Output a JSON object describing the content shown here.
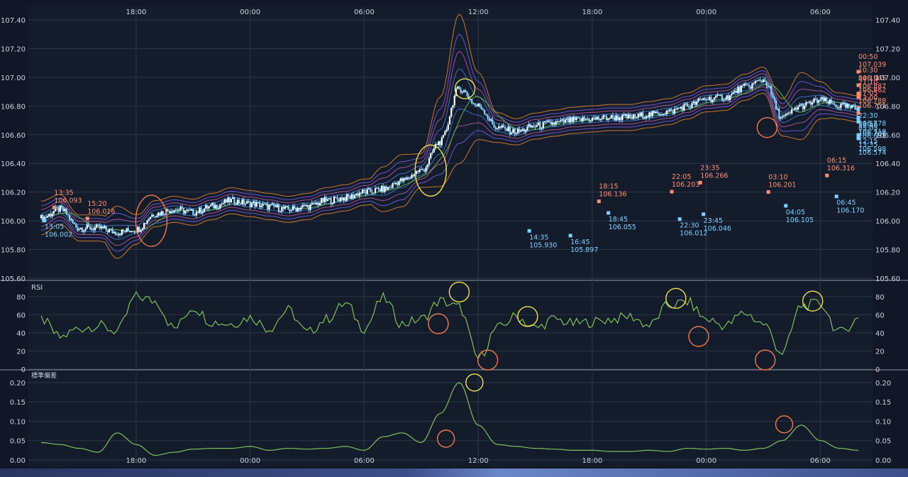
{
  "colors": {
    "background": "#111726",
    "panel": "#131b2b",
    "grid": "#2b3548",
    "axis_text": "#c9d1dd",
    "candle": "#8fd3ff",
    "high_label": "#ff8f70",
    "low_label": "#7fd0ff",
    "rsi_line": "#7fbf5a",
    "std_line": "#7fbf5a",
    "circle_orange": "#f07a4a",
    "circle_yellow": "#f0e050",
    "band_outer": "#e8872a",
    "band_mid": "#7d5ce6",
    "band_inner": "#c05aa8",
    "band_core": "#4a7ad0",
    "ma_line": "#5fb04a"
  },
  "time_axis": {
    "top_ticks": [
      "18:00",
      "00:00",
      "06:00",
      "12:00",
      "18:00",
      "00:00",
      "06:00"
    ],
    "bottom_ticks": [
      "18:00",
      "00:00",
      "06:00",
      "12:00",
      "18:00",
      "00:00",
      "06:00"
    ]
  },
  "price_panel": {
    "yticks": [
      "107.40",
      "107.20",
      "107.00",
      "106.80",
      "106.60",
      "106.40",
      "106.20",
      "106.00",
      "105.80",
      "105.60"
    ],
    "annotations": [
      {
        "time": "13:35",
        "price": "106.093",
        "kind": "high"
      },
      {
        "time": "13:05",
        "price": "106.002",
        "kind": "low"
      },
      {
        "time": "15:20",
        "price": "106.016",
        "kind": "high"
      },
      {
        "time": "14:35",
        "price": "105.930",
        "kind": "low"
      },
      {
        "time": "16:45",
        "price": "105.897",
        "kind": "low"
      },
      {
        "time": "18:15",
        "price": "106.136",
        "kind": "high"
      },
      {
        "time": "18:45",
        "price": "106.055",
        "kind": "low"
      },
      {
        "time": "22:05",
        "price": "106.203",
        "kind": "high"
      },
      {
        "time": "22:30",
        "price": "106.012",
        "kind": "low"
      },
      {
        "time": "23:35",
        "price": "106.266",
        "kind": "high"
      },
      {
        "time": "23:45",
        "price": "106.046",
        "kind": "low"
      },
      {
        "time": "03:10",
        "price": "106.201",
        "kind": "high"
      },
      {
        "time": "04:05",
        "price": "106.105",
        "kind": "low"
      },
      {
        "time": "06:15",
        "price": "106.316",
        "kind": "high"
      },
      {
        "time": "06:45",
        "price": "106.170",
        "kind": "low"
      },
      {
        "time": "10:30",
        "price": "106.945",
        "kind": "high"
      },
      {
        "time": "12:15",
        "price": "106.598",
        "kind": "low"
      },
      {
        "time": "13:00",
        "price": "106.751",
        "kind": "high"
      },
      {
        "time": "13:35",
        "price": "106.574",
        "kind": "low"
      },
      {
        "time": "17:05",
        "price": "106.788",
        "kind": "high"
      },
      {
        "time": "19:40",
        "price": "106.708",
        "kind": "low"
      },
      {
        "time": "21:10",
        "price": "106.862",
        "kind": "high"
      },
      {
        "time": "22:30",
        "price": "106.778",
        "kind": "low"
      },
      {
        "time": "00:50",
        "price": "107.039",
        "kind": "high"
      },
      {
        "time": "01:55",
        "price": "106.719",
        "kind": "low"
      },
      {
        "time": "04:10",
        "price": "106.887",
        "kind": "high"
      },
      {
        "time": "05:05",
        "price": "106.691",
        "kind": "low"
      }
    ]
  },
  "rsi_panel": {
    "label": "RSI",
    "yticks": [
      "80",
      "60",
      "40",
      "20",
      "0"
    ]
  },
  "std_panel": {
    "label": "標準偏差",
    "yticks": [
      "0.20",
      "0.15",
      "0.10",
      "0.05",
      "0.00"
    ]
  },
  "chart_data": [
    {
      "type": "line",
      "title": "",
      "xlabel": "",
      "ylabel": "",
      "ylim": [
        105.6,
        107.4
      ],
      "x_hours": [
        0,
        1,
        2,
        3,
        4,
        5,
        6,
        7,
        8,
        9,
        10,
        11,
        12,
        13,
        14,
        15,
        16,
        17,
        18,
        19,
        20,
        21,
        22,
        23,
        24,
        25,
        26,
        27,
        28,
        29,
        30,
        31,
        32,
        33,
        34,
        35,
        36,
        37,
        38,
        39,
        40,
        41,
        42,
        43
      ],
      "series": [
        {
          "name": "",
          "values": [
            106.02,
            106.08,
            105.95,
            105.95,
            105.92,
            105.94,
            106.05,
            106.08,
            106.06,
            106.1,
            106.14,
            106.12,
            106.1,
            106.08,
            106.1,
            106.14,
            106.16,
            106.2,
            106.22,
            106.28,
            106.35,
            106.55,
            106.92,
            106.8,
            106.65,
            106.62,
            106.66,
            106.68,
            106.7,
            106.71,
            106.72,
            106.72,
            106.74,
            106.76,
            106.8,
            106.85,
            106.86,
            106.93,
            106.98,
            106.72,
            106.8,
            106.84,
            106.8,
            106.78
          ]
        }
      ]
    },
    {
      "type": "line",
      "title": "RSI",
      "ylim": [
        0,
        90
      ],
      "x_hours": [
        0,
        1,
        2,
        3,
        4,
        5,
        6,
        7,
        8,
        9,
        10,
        11,
        12,
        13,
        14,
        15,
        16,
        17,
        18,
        19,
        20,
        21,
        22,
        23,
        24,
        25,
        26,
        27,
        28,
        29,
        30,
        31,
        32,
        33,
        34,
        35,
        36,
        37,
        38,
        39,
        40,
        41,
        42,
        43
      ],
      "series": [
        {
          "name": "RSI",
          "values": [
            55,
            35,
            45,
            48,
            42,
            80,
            75,
            45,
            68,
            52,
            50,
            57,
            45,
            65,
            40,
            55,
            72,
            45,
            78,
            50,
            55,
            75,
            68,
            12,
            45,
            58,
            45,
            55,
            50,
            52,
            55,
            58,
            48,
            70,
            74,
            55,
            48,
            62,
            50,
            18,
            70,
            72,
            40,
            55
          ]
        }
      ]
    },
    {
      "type": "line",
      "title": "標準偏差",
      "ylim": [
        0,
        0.22
      ],
      "x_hours": [
        0,
        1,
        2,
        3,
        4,
        5,
        6,
        7,
        8,
        9,
        10,
        11,
        12,
        13,
        14,
        15,
        16,
        17,
        18,
        19,
        20,
        21,
        22,
        23,
        24,
        25,
        26,
        27,
        28,
        29,
        30,
        31,
        32,
        33,
        34,
        35,
        36,
        37,
        38,
        39,
        40,
        41,
        42,
        43
      ],
      "series": [
        {
          "name": "",
          "values": [
            0.045,
            0.04,
            0.03,
            0.02,
            0.07,
            0.04,
            0.012,
            0.02,
            0.028,
            0.03,
            0.03,
            0.035,
            0.025,
            0.03,
            0.028,
            0.03,
            0.035,
            0.025,
            0.06,
            0.07,
            0.045,
            0.12,
            0.2,
            0.09,
            0.04,
            0.035,
            0.03,
            0.028,
            0.025,
            0.025,
            0.022,
            0.022,
            0.025,
            0.022,
            0.03,
            0.028,
            0.03,
            0.025,
            0.03,
            0.05,
            0.09,
            0.05,
            0.03,
            0.025
          ]
        }
      ]
    }
  ],
  "highlights": {
    "price_circles": [
      {
        "hour": 5.8,
        "value": 106.0,
        "color": "orange"
      },
      {
        "hour": 20.5,
        "value": 106.35,
        "color": "yellow"
      },
      {
        "hour": 22.3,
        "value": 106.92,
        "color": "yellow"
      },
      {
        "hour": 38.2,
        "value": 106.65,
        "color": "orange"
      }
    ],
    "rsi_circles": [
      {
        "hour": 20.9,
        "value": 50,
        "color": "orange"
      },
      {
        "hour": 22.0,
        "value": 85,
        "color": "yellow"
      },
      {
        "hour": 23.5,
        "value": 10,
        "color": "orange"
      },
      {
        "hour": 25.6,
        "value": 58,
        "color": "yellow"
      },
      {
        "hour": 33.4,
        "value": 78,
        "color": "yellow"
      },
      {
        "hour": 34.6,
        "value": 36,
        "color": "orange"
      },
      {
        "hour": 38.1,
        "value": 10,
        "color": "orange"
      },
      {
        "hour": 40.6,
        "value": 75,
        "color": "yellow"
      }
    ],
    "std_circles": [
      {
        "hour": 21.3,
        "value": 0.055,
        "color": "orange"
      },
      {
        "hour": 22.8,
        "value": 0.2,
        "color": "yellow"
      },
      {
        "hour": 39.1,
        "value": 0.092,
        "color": "orange"
      }
    ]
  }
}
